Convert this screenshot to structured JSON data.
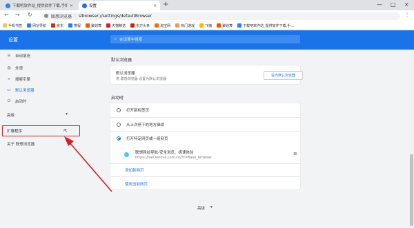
{
  "tabs": [
    {
      "label": "下载吧软件站_提供软件下载,手机"
    },
    {
      "label": "设置"
    }
  ],
  "newtab": "+",
  "window": {
    "min": "—",
    "max": "□",
    "close": "×"
  },
  "tab_close": "×",
  "nav": {
    "back": "←",
    "forward": "→",
    "reload": "↻"
  },
  "address": {
    "brand": "联想浏览器",
    "sep": "|",
    "url": "slbrowser://settings/defaultBrowser",
    "more": "⋮"
  },
  "bookmarks": [
    {
      "label": "手机书签",
      "color": "#4a90d9"
    },
    {
      "label": "网址导航",
      "color": "#2f80ed"
    },
    {
      "label": "京东",
      "color": "#e1251b"
    },
    {
      "label": "携程",
      "color": "#2a80e4"
    },
    {
      "label": "聚划算",
      "color": "#ff5000"
    },
    {
      "label": "天猫精选",
      "color": "#e0142b"
    },
    {
      "label": "东方头条",
      "color": "#d81e06"
    },
    {
      "label": "淘宝网",
      "color": "#ff6a00"
    },
    {
      "label": "热门游戏",
      "color": "#f2994a"
    },
    {
      "label": "飞猪",
      "color": "#ffb800"
    },
    {
      "label": "聚划算",
      "color": "#ff4a00"
    },
    {
      "label": "下载吧软件站_提供软件下载,手...",
      "color": "#2f80ed"
    }
  ],
  "header": {
    "title": "设置",
    "search_placeholder": "在设置中搜索"
  },
  "sidebar": {
    "items": [
      {
        "label": "自动填充",
        "icon": "≡"
      },
      {
        "label": "外观",
        "icon": "◍"
      },
      {
        "label": "搜索引擎",
        "icon": "⌕"
      },
      {
        "label": "默认浏览器",
        "icon": "▭"
      },
      {
        "label": "启动时",
        "icon": "⏻"
      }
    ],
    "advanced": "高级",
    "advanced_arrow": "▾",
    "extensions": "扩展程序",
    "extensions_icon": "⇱",
    "about": "关于 联想浏览器"
  },
  "default_browser": {
    "section": "默认浏览器",
    "title": "默认浏览器",
    "subtitle": "将 联想浏览器 设置为默认浏览器",
    "button": "设为默认浏览器"
  },
  "startup": {
    "section": "启动时",
    "options": [
      "打开新标签页",
      "从上次停下的地方继续",
      "打开特定网页或一组网页"
    ],
    "selected_index": 2,
    "page": {
      "name": "联想网址导航-安全浏览、极速体验",
      "url": "https://hao.lenovo.com.cn/?c=flash_browser",
      "menu": "≡"
    },
    "add_page": "添加新网页",
    "use_current": "使用当前网页"
  },
  "bottom": {
    "advanced": "高级",
    "arrow": "▾"
  },
  "colors": {
    "accent": "#1a73e8",
    "annotation": "#d51e25"
  }
}
